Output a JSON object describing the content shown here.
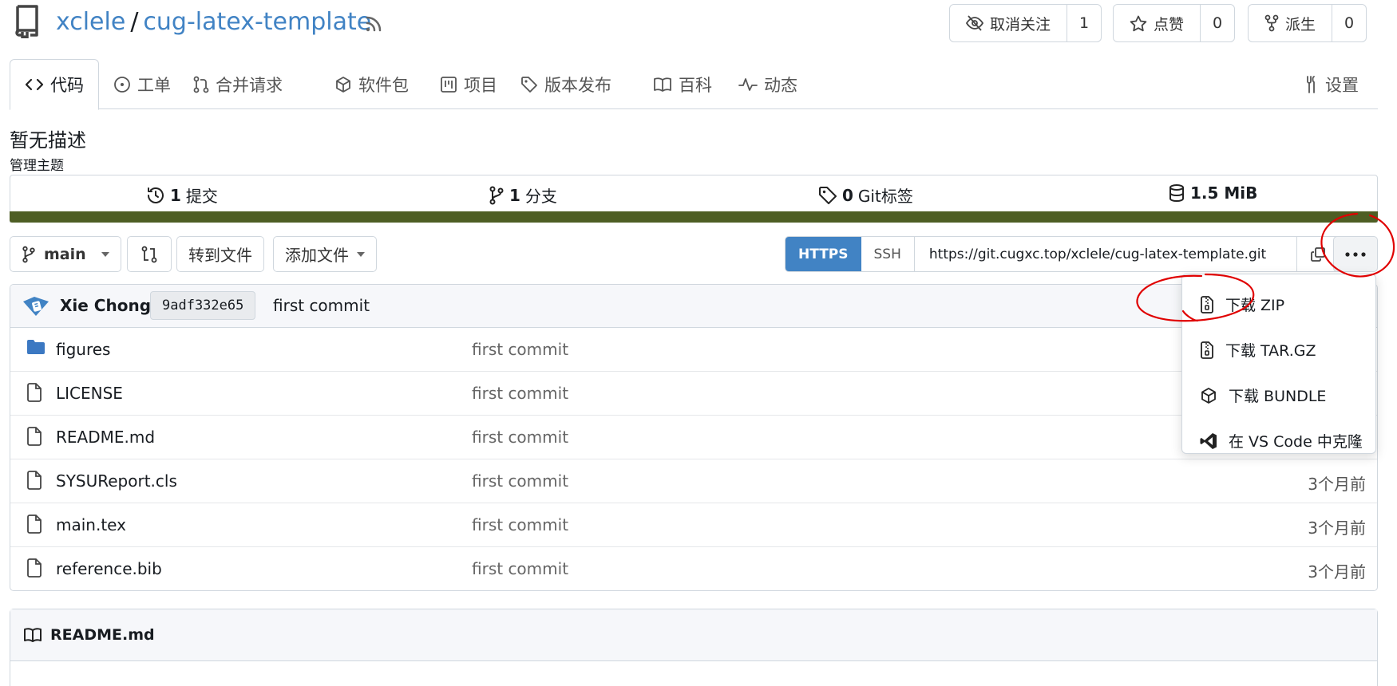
{
  "header": {
    "owner": "xclele",
    "separator": "/",
    "repo": "cug-latex-template",
    "watch": {
      "label": "取消关注",
      "count": "1"
    },
    "star": {
      "label": "点赞",
      "count": "0"
    },
    "fork": {
      "label": "派生",
      "count": "0"
    }
  },
  "tabs": [
    {
      "label": "代码",
      "icon": "code-icon",
      "active": true
    },
    {
      "label": "工单",
      "icon": "issue-icon"
    },
    {
      "label": "合并请求",
      "icon": "pull-request-icon"
    },
    {
      "label": "软件包",
      "icon": "package-icon"
    },
    {
      "label": "项目",
      "icon": "project-icon"
    },
    {
      "label": "版本发布",
      "icon": "tag-icon"
    },
    {
      "label": "百科",
      "icon": "book-icon"
    },
    {
      "label": "动态",
      "icon": "pulse-icon"
    },
    {
      "label": "设置",
      "icon": "tools-icon"
    }
  ],
  "repo": {
    "description": "暂无描述",
    "manage_topics": "管理主题"
  },
  "stats": {
    "commits": {
      "count": "1",
      "label": "提交"
    },
    "branches": {
      "count": "1",
      "label": "分支"
    },
    "tags": {
      "count": "0",
      "label": "Git标签"
    },
    "size": "1.5 MiB",
    "language_color": "#4e5e24"
  },
  "toolbar": {
    "branch": "main",
    "go_to_file": "转到文件",
    "add_file": "添加文件",
    "clone": {
      "https": "HTTPS",
      "ssh": "SSH",
      "url": "https://git.cugxc.top/xclele/cug-latex-template.git"
    }
  },
  "latest_commit": {
    "author": "Xie Chong",
    "sha": "9adf332e65",
    "message": "first commit"
  },
  "files": [
    {
      "name": "figures",
      "type": "folder",
      "message": "first commit",
      "time": ""
    },
    {
      "name": "LICENSE",
      "type": "file",
      "message": "first commit",
      "time": ""
    },
    {
      "name": "README.md",
      "type": "file",
      "message": "first commit",
      "time": ""
    },
    {
      "name": "SYSUReport.cls",
      "type": "file",
      "message": "first commit",
      "time": "3个月前"
    },
    {
      "name": "main.tex",
      "type": "file",
      "message": "first commit",
      "time": "3个月前"
    },
    {
      "name": "reference.bib",
      "type": "file",
      "message": "first commit",
      "time": "3个月前"
    }
  ],
  "readme": {
    "title": "README.md"
  },
  "dropdown": {
    "items": [
      {
        "label": "下载 ZIP",
        "icon": "file-zip-icon"
      },
      {
        "label": "下载 TAR.GZ",
        "icon": "file-zip-icon"
      },
      {
        "label": "下载 BUNDLE",
        "icon": "package-icon"
      },
      {
        "label": "在 VS Code 中克隆",
        "icon": "vscode-icon"
      }
    ]
  },
  "colors": {
    "link": "#4183c4",
    "primary": "#4183c4",
    "annotation": "#e00000",
    "folder": "#3b78c2"
  }
}
